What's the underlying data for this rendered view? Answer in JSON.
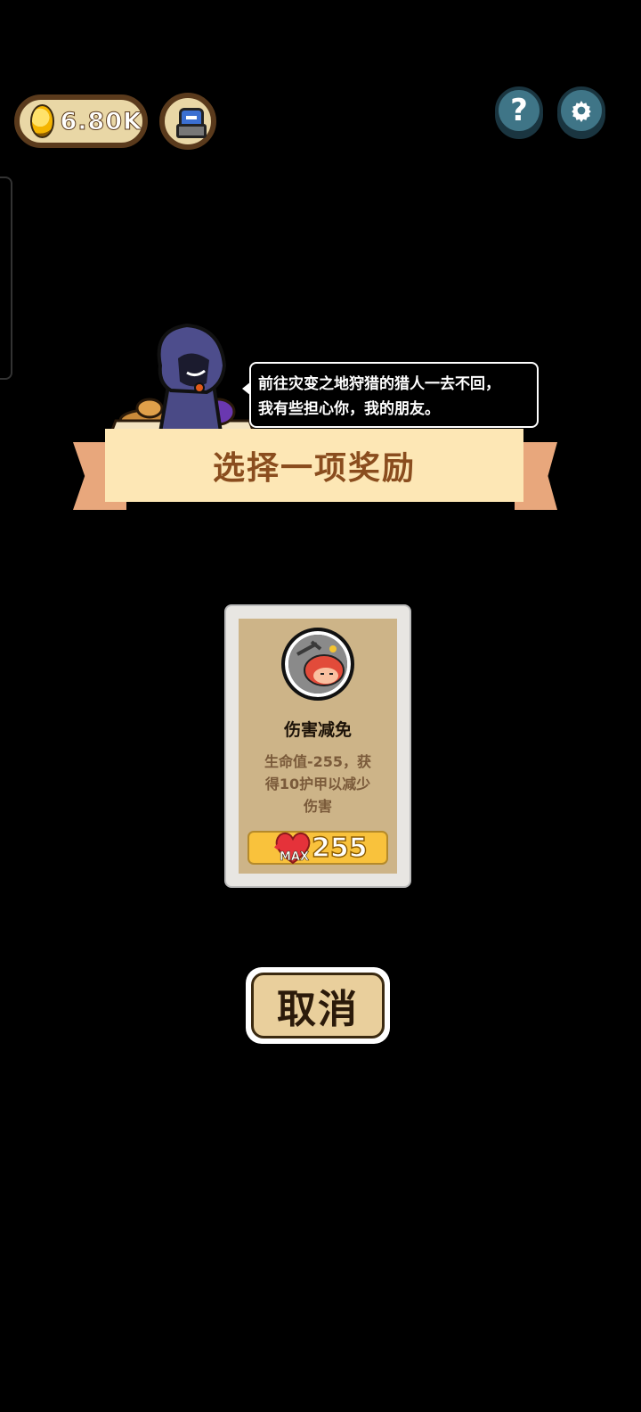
{
  "topbar": {
    "coins": "6.80K",
    "help_label": "?",
    "settings_icon": "gear-icon",
    "chest_icon": "chest-icon"
  },
  "dialog": {
    "speech_line1": "前往灾变之地狩猎的猎人一去不回，",
    "speech_line2": "我有些担心你，我的朋友。"
  },
  "banner": {
    "title": "选择一项奖励"
  },
  "reward_card": {
    "name": "伤害减免",
    "desc_line1": "生命值-255，获",
    "desc_line2": "得10护甲以减少",
    "desc_line3": "伤害",
    "max_label": "MAX",
    "max_value": "255",
    "icon": "shield-hero-icon"
  },
  "cancel_label": "取消",
  "colors": {
    "banner_bg": "#fde7b5",
    "banner_text": "#8a4d1e",
    "ribbon": "#e8a77c",
    "card_inner": "#cdb488",
    "max_bar": "#f9c23c",
    "round_button": "#3f7587"
  }
}
